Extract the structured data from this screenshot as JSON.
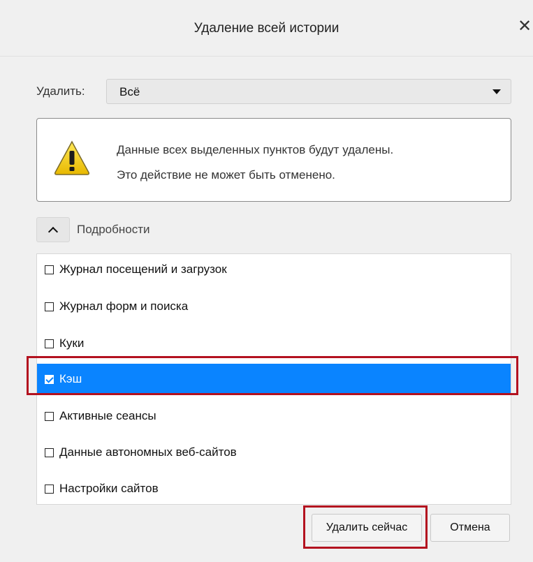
{
  "dialog": {
    "title": "Удаление всей истории",
    "close_icon": "close-icon"
  },
  "range": {
    "label": "Удалить:",
    "value": "Всё"
  },
  "warning": {
    "icon": "warning-icon",
    "line1": "Данные всех выделенных пунктов будут удалены.",
    "line2": "Это действие не может быть отменено."
  },
  "details": {
    "label": "Подробности",
    "expanded": true
  },
  "items": [
    {
      "label": "Журнал посещений и загрузок",
      "checked": false,
      "selected": false
    },
    {
      "label": "Журнал форм и поиска",
      "checked": false,
      "selected": false
    },
    {
      "label": "Куки",
      "checked": false,
      "selected": false
    },
    {
      "label": "Кэш",
      "checked": true,
      "selected": true
    },
    {
      "label": "Активные сеансы",
      "checked": false,
      "selected": false
    },
    {
      "label": "Данные автономных веб-сайтов",
      "checked": false,
      "selected": false
    },
    {
      "label": "Настройки сайтов",
      "checked": false,
      "selected": false
    }
  ],
  "buttons": {
    "delete_now": "Удалить сейчас",
    "cancel": "Отмена"
  },
  "colors": {
    "selection": "#0a84ff",
    "annotation": "#b3121f",
    "warning_fill": "#f2d100"
  }
}
